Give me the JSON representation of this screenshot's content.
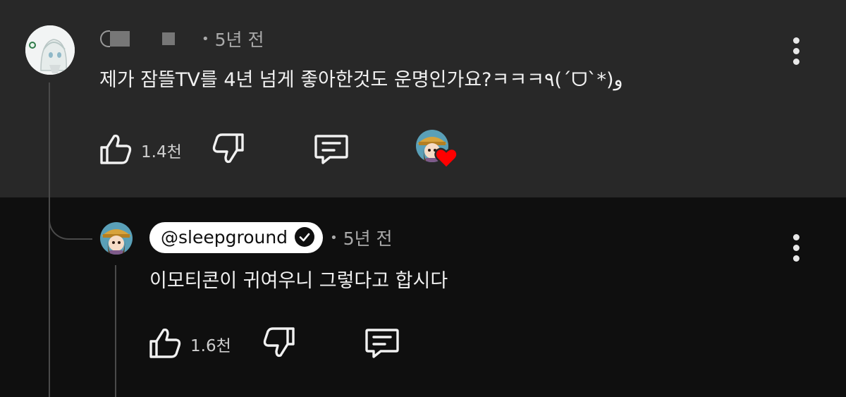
{
  "comment": {
    "time": "5년 전",
    "text": "제가 잠뜰TV를 4년 넘게 좋아한것도 운명인가요?ㅋㅋㅋ٩(ˊᗜˋ*)و",
    "like_count": "1.4천",
    "icons": {
      "like": "thumbs-up-icon",
      "dislike": "thumbs-down-icon",
      "reply": "reply-icon",
      "creator_heart": "creator-heart-badge",
      "more": "more-vert-icon"
    }
  },
  "reply": {
    "author": "@sleepground",
    "verified": true,
    "time": "5년 전",
    "text": "이모티콘이 귀여우니 그렇다고 합시다",
    "like_count": "1.6천",
    "icons": {
      "like": "thumbs-up-icon",
      "dislike": "thumbs-down-icon",
      "reply": "reply-icon",
      "verified": "verified-check-icon",
      "more": "more-vert-icon"
    }
  },
  "colors": {
    "top_background": "#282828",
    "bottom_background": "#0f0f0f",
    "heart": "#ff0000",
    "text": "#f1f1f1",
    "meta": "#aaaaaa"
  }
}
